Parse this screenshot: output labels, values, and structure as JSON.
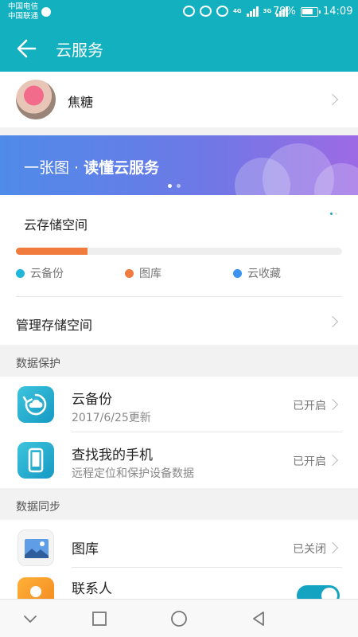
{
  "status_bar": {
    "carrier_1": "中国电信",
    "carrier_2": "中国联通",
    "network_1": "4G",
    "network_2": "3G",
    "battery_percent": "79%",
    "battery_level": 0.79,
    "time": "14:09"
  },
  "app_bar": {
    "title": "云服务",
    "back_icon": "arrow-left-icon"
  },
  "profile": {
    "name": "焦糖"
  },
  "banner": {
    "text_light": "一张图 · ",
    "text_bold": "读懂云服务",
    "page_count": 2,
    "active_page": 1
  },
  "storage": {
    "title": "云存储空间",
    "used_fraction": 0.22,
    "legend": [
      {
        "label": "云备份",
        "color": "#1fb6d9"
      },
      {
        "label": "图库",
        "color": "#f07b3c"
      },
      {
        "label": "云收藏",
        "color": "#3a93f0"
      }
    ],
    "manage_label": "管理存储空间"
  },
  "data_protection": {
    "header": "数据保护",
    "items": [
      {
        "title": "云备份",
        "subtitle": "2017/6/25更新",
        "status": "已开启",
        "icon": "cloud-backup-icon"
      },
      {
        "title": "查找我的手机",
        "subtitle": "远程定位和保护设备数据",
        "status": "已开启",
        "icon": "find-phone-icon"
      }
    ]
  },
  "data_sync": {
    "header": "数据同步",
    "items": [
      {
        "title": "图库",
        "status": "已关闭",
        "icon": "gallery-icon"
      },
      {
        "title": "联系人",
        "icon": "contacts-icon",
        "toggle_on": true
      }
    ]
  },
  "nav_bar": {
    "icons": [
      "nav-down-icon",
      "nav-recents-icon",
      "nav-home-icon",
      "nav-back-icon"
    ]
  },
  "colors": {
    "accent": "#13b0c0",
    "used_bar": "#f07b3c",
    "toggle": "#15a3c2"
  }
}
